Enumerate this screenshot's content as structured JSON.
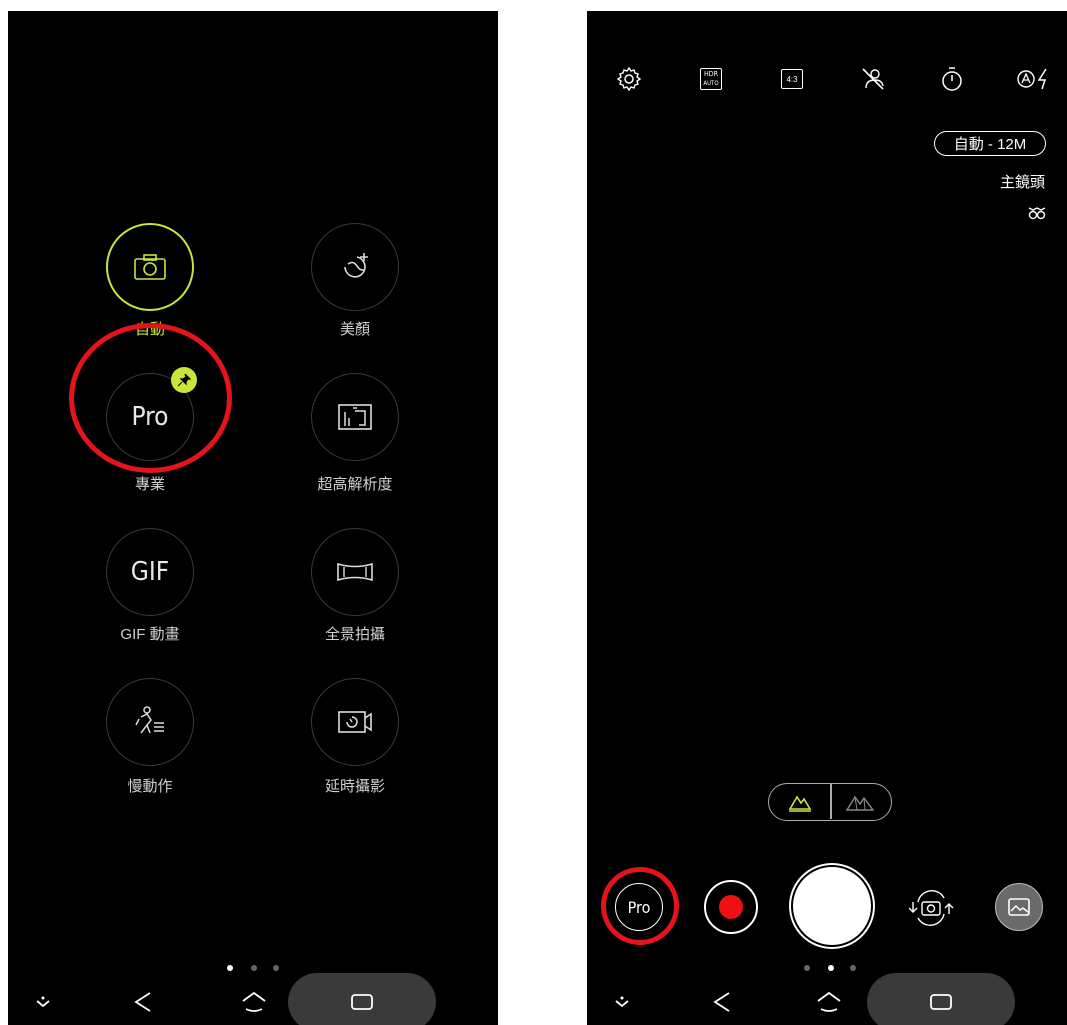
{
  "left_screen": {
    "modes": [
      {
        "id": "auto",
        "label": "自動",
        "icon": "camera-icon",
        "active": true
      },
      {
        "id": "beauty",
        "label": "美顏",
        "icon": "beauty-face-icon",
        "active": false
      },
      {
        "id": "pro",
        "label": "專業",
        "icon_text": "Pro",
        "active": false,
        "pinned": true
      },
      {
        "id": "super-resolution",
        "label": "超高解析度",
        "icon": "super-resolution-icon",
        "active": false
      },
      {
        "id": "gif",
        "label": "GIF 動畫",
        "icon_text": "GIF",
        "active": false
      },
      {
        "id": "panorama",
        "label": "全景拍攝",
        "icon": "panorama-icon",
        "active": false
      },
      {
        "id": "slow-motion",
        "label": "慢動作",
        "icon": "slow-motion-icon",
        "active": false
      },
      {
        "id": "time-lapse",
        "label": "延時攝影",
        "icon": "time-lapse-icon",
        "active": false
      }
    ],
    "page_indicator": {
      "total": 3,
      "current": 1
    },
    "highlight_color": "#e5141b",
    "accent_color": "#c8e63a"
  },
  "right_screen": {
    "top_bar": [
      "settings-icon",
      "hdr-auto-icon",
      "aspect-ratio-icon",
      "beautify-off-icon",
      "timer-icon",
      "flash-auto-icon"
    ],
    "hdr_text_top": "HDR",
    "hdr_text_bottom": "AUTO",
    "aspect_text": "4:3",
    "resolution_badge": "自動 - 12M",
    "lens_label": "主鏡頭",
    "scene_toggle": [
      "scene-landscape-icon",
      "scene-mountain-icon"
    ],
    "bottom_controls": {
      "mode_button_text": "Pro",
      "record_icon": "record-icon",
      "shutter_icon": "shutter-button",
      "switch_icon": "switch-camera-icon",
      "gallery_icon": "gallery-icon"
    },
    "page_indicator": {
      "total": 3,
      "current": 2
    }
  },
  "nav_bar": [
    "collapse-icon",
    "back-icon",
    "home-icon",
    "recents-icon"
  ]
}
